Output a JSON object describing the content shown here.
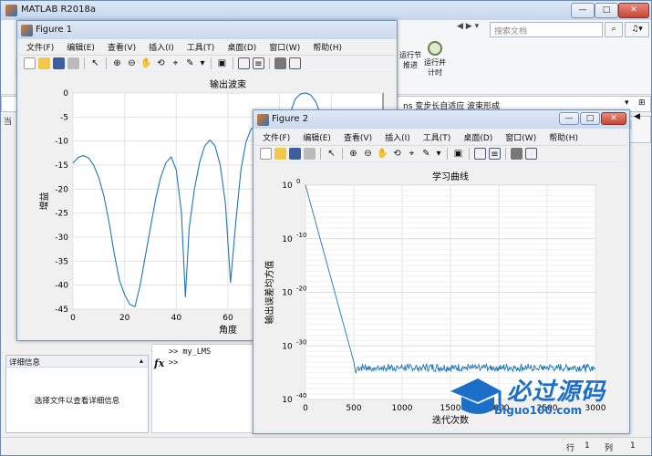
{
  "matlab": {
    "title": "MATLAB R2018a",
    "search_placeholder": "搜索文档",
    "ribbon_run_section": "运行节",
    "ribbon_advance": "推进",
    "ribbon_run_time_1": "运行并",
    "ribbon_run_time_2": "计时",
    "breadcrumb": "ns 变步长自适应 波束形成",
    "command_lines": [
      ">> my_LMS",
      ">>"
    ],
    "fx": "fx",
    "details_title": "详细信息",
    "details_text": "选择文件以查看详细信息",
    "status_row_label": "行",
    "status_row_value": "1",
    "status_col_label": "列",
    "status_col_value": "1"
  },
  "menus": [
    "文件(F)",
    "编辑(E)",
    "查看(V)",
    "插入(I)",
    "工具(T)",
    "桌面(D)",
    "窗口(W)",
    "帮助(H)"
  ],
  "figure1": {
    "window_title": "Figure 1",
    "chart_data": {
      "type": "line",
      "title": "输出波束",
      "xlabel": "角度",
      "ylabel": "增益",
      "xlim": [
        0,
        120
      ],
      "ylim": [
        -45,
        0
      ],
      "xticks": [
        "0",
        "20",
        "40",
        "60",
        "80",
        "100"
      ],
      "yticks": [
        "0",
        "-5",
        "-10",
        "-15",
        "-20",
        "-25",
        "-30",
        "-35",
        "-40",
        "-45"
      ],
      "grid": true,
      "series": [
        {
          "color": "#1f77b4",
          "x": [
            0,
            2,
            4,
            6,
            8,
            10,
            12,
            14,
            16,
            18,
            20,
            22,
            24,
            26,
            28,
            30,
            32,
            34,
            36,
            38,
            40,
            42,
            43.5,
            45,
            47,
            49,
            51,
            53,
            55,
            57,
            59,
            61,
            63,
            65,
            67,
            69,
            71,
            73,
            75,
            77,
            78.5,
            80,
            82,
            84,
            86,
            88,
            90,
            92,
            94,
            96,
            98,
            100,
            101.5,
            103,
            105,
            107,
            108,
            110
          ],
          "y": [
            -14.6,
            -13.4,
            -13,
            -13.5,
            -15,
            -17.6,
            -21.5,
            -27,
            -33.5,
            -39,
            -42,
            -44,
            -44.5,
            -40,
            -34,
            -28,
            -22,
            -17.5,
            -14.5,
            -13.3,
            -16,
            -25,
            -42.5,
            -28,
            -20,
            -14.5,
            -11,
            -9.8,
            -11,
            -15,
            -23,
            -39.5,
            -27,
            -16,
            -10.2,
            -7.4,
            -7,
            -9,
            -14,
            -26,
            -33.5,
            -20,
            -10,
            -4.3,
            -1.3,
            -0.2,
            0,
            -0.4,
            -1.8,
            -4.8,
            -10.5,
            -21,
            -32,
            -22,
            -14,
            -10,
            -9.5,
            -11
          ]
        }
      ]
    }
  },
  "figure2": {
    "window_title": "Figure 2",
    "chart_data": {
      "type": "line",
      "title": "学习曲线",
      "xlabel": "迭代次数",
      "ylabel": "输出误差均方值",
      "xlim": [
        0,
        3000
      ],
      "yscale": "log",
      "ylim": [
        1e-40,
        1
      ],
      "xticks": [
        "0",
        "500",
        "1000",
        "1500",
        "2000",
        "2500",
        "3000"
      ],
      "yticks": [
        "10^0",
        "10^-10",
        "10^-20",
        "10^-30",
        "10^-40"
      ],
      "grid": true,
      "series": [
        {
          "color": "#1f77b4",
          "x": [
            0,
            500,
            520,
            600,
            3000
          ],
          "y": [
            1,
            1e-33,
            1e-35,
            1e-34,
            1e-34
          ],
          "noise_floor_exponent": -34
        }
      ]
    }
  },
  "watermark": {
    "text": "必过源码",
    "url": "Biguo100.com"
  }
}
